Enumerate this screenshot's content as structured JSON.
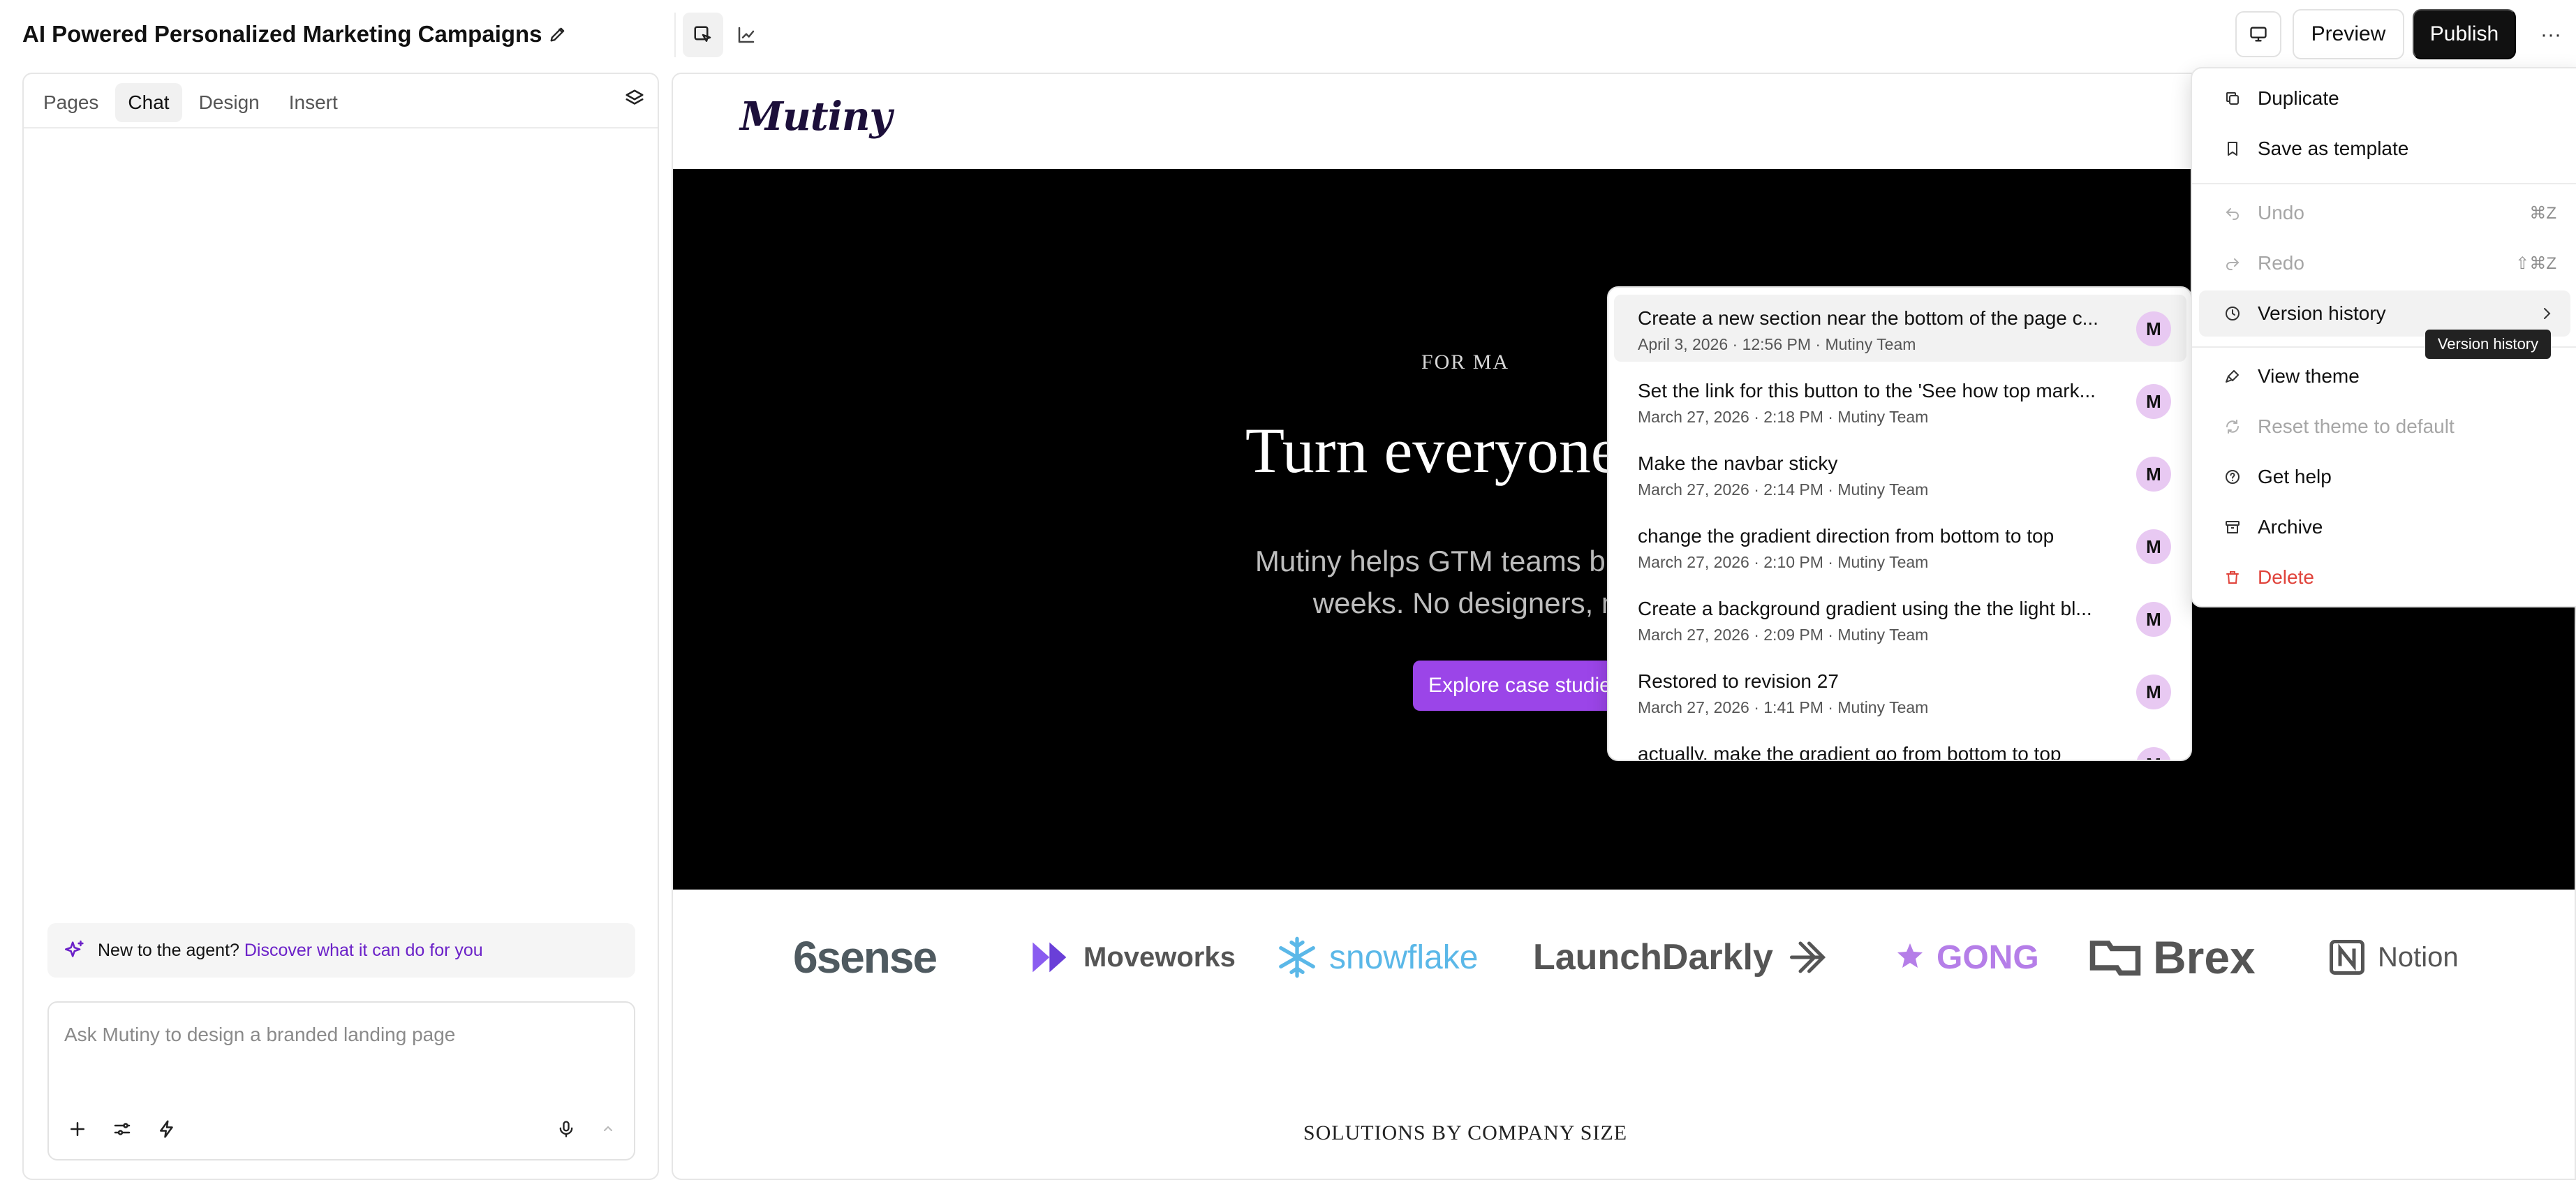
{
  "topbar": {
    "title": "AI Powered Personalized Marketing Campaigns",
    "preview_label": "Preview",
    "publish_label": "Publish",
    "more_label": "···"
  },
  "left_panel": {
    "tabs": [
      {
        "label": "Pages"
      },
      {
        "label": "Chat"
      },
      {
        "label": "Design"
      },
      {
        "label": "Insert"
      }
    ],
    "active_tab": "Chat",
    "agent_banner": {
      "lead": "New to the agent?",
      "link": "Discover what it can do for you"
    },
    "chat_input": {
      "placeholder": "Ask Mutiny to design a branded landing page",
      "value": ""
    }
  },
  "site": {
    "logo": "Mutiny",
    "eyebrow": "FOR MA",
    "title": "Turn everyone in",
    "subtitle_line1": "Mutiny helps GTM teams build p",
    "subtitle_line2": "weeks. No designers, n",
    "cta": "Explore case studie",
    "customer_logos": [
      "6sense",
      "Moveworks",
      "snowflake",
      "LaunchDarkly",
      "GONG",
      "Brex",
      "Notion"
    ],
    "section_label": "SOLUTIONS BY COMPANY SIZE",
    "colors": {
      "hero_bg": "#000000",
      "cta": "#9b45e8"
    }
  },
  "version_history": {
    "items": [
      {
        "title": "Create a new section near the bottom of the page c...",
        "meta": "April 3, 2026 · 12:56 PM · Mutiny Team",
        "avatar": "M"
      },
      {
        "title": "Set the link for this button to the 'See how top mark...",
        "meta": "March 27, 2026 · 2:18 PM · Mutiny Team",
        "avatar": "M"
      },
      {
        "title": "Make the navbar sticky",
        "meta": "March 27, 2026 · 2:14 PM · Mutiny Team",
        "avatar": "M"
      },
      {
        "title": "change the gradient direction from bottom to top",
        "meta": "March 27, 2026 · 2:10 PM · Mutiny Team",
        "avatar": "M"
      },
      {
        "title": "Create a background gradient using the the light bl...",
        "meta": "March 27, 2026 · 2:09 PM · Mutiny Team",
        "avatar": "M"
      },
      {
        "title": "Restored to revision 27",
        "meta": "March 27, 2026 · 1:41 PM · Mutiny Team",
        "avatar": "M"
      },
      {
        "title": "actually, make the gradient go from bottom to top",
        "meta": "",
        "avatar": "M"
      }
    ]
  },
  "menu": {
    "duplicate": "Duplicate",
    "save_template": "Save as template",
    "undo": "Undo",
    "undo_shortcut": "⌘Z",
    "redo": "Redo",
    "redo_shortcut": "⇧⌘Z",
    "version_history": "Version history",
    "view_theme": "View theme",
    "reset_theme": "Reset theme to default",
    "get_help": "Get help",
    "archive": "Archive",
    "delete": "Delete",
    "tooltip": "Version history",
    "colors": {
      "danger": "#e0433b"
    }
  }
}
